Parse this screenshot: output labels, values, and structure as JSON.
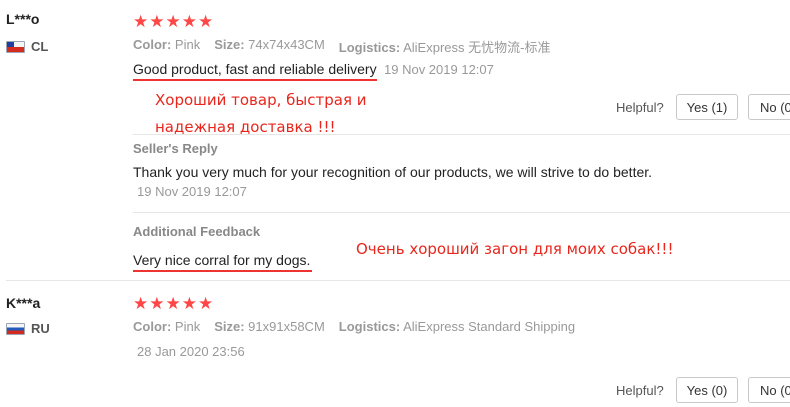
{
  "reviews": [
    {
      "user": "L***o",
      "country": "CL",
      "flag_icon": "chile-flag-icon",
      "rating": "★★★★★",
      "color_label": "Color:",
      "color_value": "Pink",
      "size_label": "Size:",
      "size_value": "74x74x43CM",
      "logistics_label": "Logistics:",
      "logistics_value": "AliExpress 无忧物流-标准",
      "text": "Good product, fast and reliable delivery",
      "date": "19 Nov 2019 12:07",
      "translation_line1": "Хороший товар, быстрая и",
      "translation_line2": "надежная доставка !!!",
      "helpful_label": "Helpful?",
      "yes_label": "Yes (1)",
      "no_label": "No (0",
      "seller_reply_title": "Seller's Reply",
      "seller_reply_text": "Thank you very much for your recognition of our products, we will strive to do better.",
      "seller_reply_date": "19 Nov 2019 12:07",
      "additional_title": "Additional Feedback",
      "additional_text": "Very nice corral for my dogs.",
      "additional_translation": "Очень хороший загон для моих собак!!!"
    },
    {
      "user": "K***a",
      "country": "RU",
      "flag_icon": "russia-flag-icon",
      "rating": "★★★★★",
      "color_label": "Color:",
      "color_value": "Pink",
      "size_label": "Size:",
      "size_value": "91x91x58CM",
      "logistics_label": "Logistics:",
      "logistics_value": "AliExpress Standard Shipping",
      "date": "28 Jan 2020 23:56",
      "helpful_label": "Helpful?",
      "yes_label": "Yes (0)",
      "no_label": "No (0"
    }
  ],
  "colors": {
    "star": "#ff4747",
    "annotation": "#e8261c"
  }
}
